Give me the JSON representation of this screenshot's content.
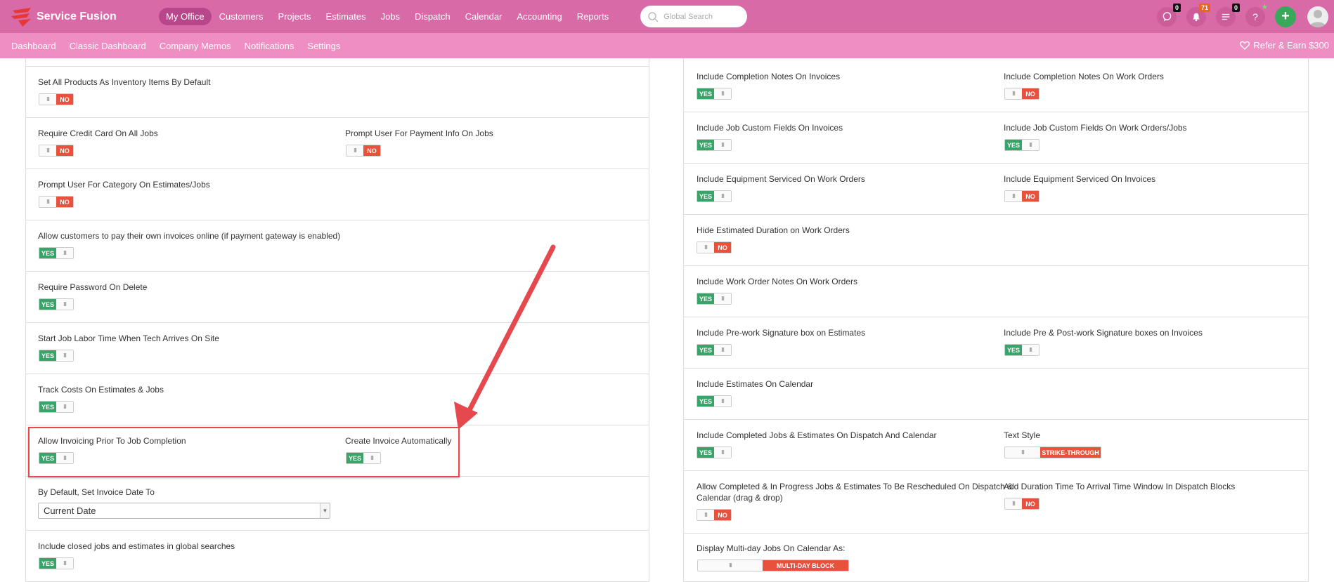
{
  "app": {
    "name": "Service Fusion"
  },
  "nav": {
    "items": [
      "My Office",
      "Customers",
      "Projects",
      "Estimates",
      "Jobs",
      "Dispatch",
      "Calendar",
      "Accounting",
      "Reports"
    ],
    "active": "My Office"
  },
  "search": {
    "placeholder": "Global Search"
  },
  "top_right": {
    "chat_badge": "0",
    "notifications_badge": "71",
    "tasks_badge": "0",
    "help_label": "?",
    "add_label": "+"
  },
  "subnav": {
    "items": [
      "Dashboard",
      "Classic Dashboard",
      "Company Memos",
      "Notifications",
      "Settings"
    ],
    "refer": "Refer & Earn $300"
  },
  "toggle_text": {
    "yes": "YES",
    "no": "NO",
    "grip": "III"
  },
  "left": {
    "set_inventory": "Set All Products As Inventory Items By Default",
    "require_cc": "Require Credit Card On All Jobs",
    "prompt_payment": "Prompt User For Payment Info On Jobs",
    "prompt_category": "Prompt User For Category On Estimates/Jobs",
    "allow_pay_online": "Allow customers to pay their own invoices online (if payment gateway is enabled)",
    "require_password": "Require Password On Delete",
    "start_labor": "Start Job Labor Time When Tech Arrives On Site",
    "track_costs": "Track Costs On Estimates & Jobs",
    "allow_invoicing": "Allow Invoicing Prior To Job Completion",
    "create_invoice": "Create Invoice Automatically",
    "invoice_date": "By Default, Set Invoice Date To",
    "invoice_date_value": "Current Date",
    "include_closed": "Include closed jobs and estimates in global searches"
  },
  "right": {
    "completion_notes_invoices": "Include Completion Notes On Invoices",
    "completion_notes_wo": "Include Completion Notes On Work Orders",
    "custom_fields_invoices": "Include Job Custom Fields On Invoices",
    "custom_fields_wo": "Include Job Custom Fields On Work Orders/Jobs",
    "equip_wo": "Include Equipment Serviced On Work Orders",
    "equip_invoices": "Include Equipment Serviced On Invoices",
    "hide_duration": "Hide Estimated Duration on Work Orders",
    "wo_notes": "Include Work Order Notes On Work Orders",
    "prework_sig": "Include Pre-work Signature box on Estimates",
    "prepost_sig": "Include Pre & Post-work Signature boxes on Invoices",
    "estimates_calendar": "Include Estimates On Calendar",
    "completed_dispatch": "Include Completed Jobs & Estimates On Dispatch And Calendar",
    "text_style": "Text Style",
    "text_style_value": "STRIKE-THROUGH",
    "allow_reschedule_1": "Allow Completed & In Progress Jobs & Estimates To Be Rescheduled On Dispatch &",
    "allow_reschedule_2": "Calendar (drag & drop)",
    "add_duration": "Add Duration Time To Arrival Time Window In Dispatch Blocks",
    "multiday": "Display Multi-day Jobs On Calendar As:",
    "multiday_value": "MULTI-DAY BLOCK"
  },
  "colors": {
    "topbar": "#d96aa8",
    "subbar": "#ee8ec2",
    "yes": "#3aa36a",
    "no": "#e8513b",
    "highlight": "#e5484d"
  }
}
